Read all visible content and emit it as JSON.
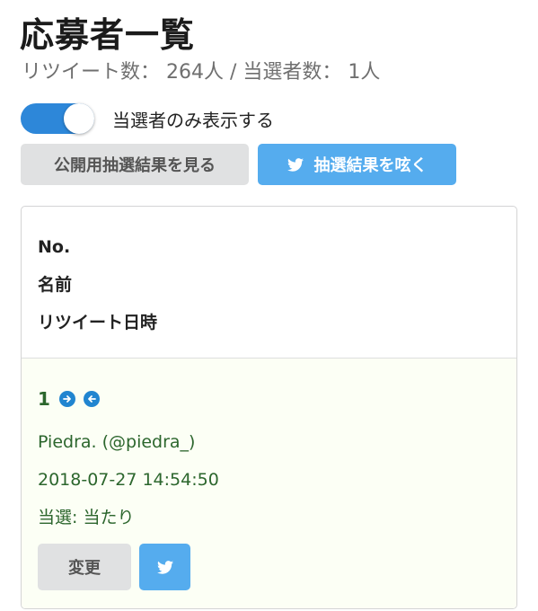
{
  "header": {
    "title": "応募者一覧",
    "subtitle": "リツイート数： 264人 / 当選者数： 1人"
  },
  "filter": {
    "toggle_on": true,
    "toggle_label": "当選者のみ表示する"
  },
  "buttons": {
    "public_results_label": "公開用抽選結果を見る",
    "tweet_results_label": "抽選結果を呟く"
  },
  "table": {
    "headers": [
      "No.",
      "名前",
      "リツイート日時"
    ],
    "rows": [
      {
        "number": "1",
        "name": "Piedra. (@piedra_)",
        "retweeted_at": "2018-07-27 14:54:50",
        "status": "当選: 当たり",
        "change_label": "変更"
      }
    ]
  },
  "colors": {
    "accent_blue": "#2d87d9",
    "twitter_blue": "#55acee",
    "winner_green": "#2c662d",
    "winner_bg": "#fcfff5"
  },
  "icons": {
    "twitter": "twitter-bird-icon",
    "next": "arrow-circle-right-icon",
    "prev": "arrow-circle-left-icon"
  }
}
